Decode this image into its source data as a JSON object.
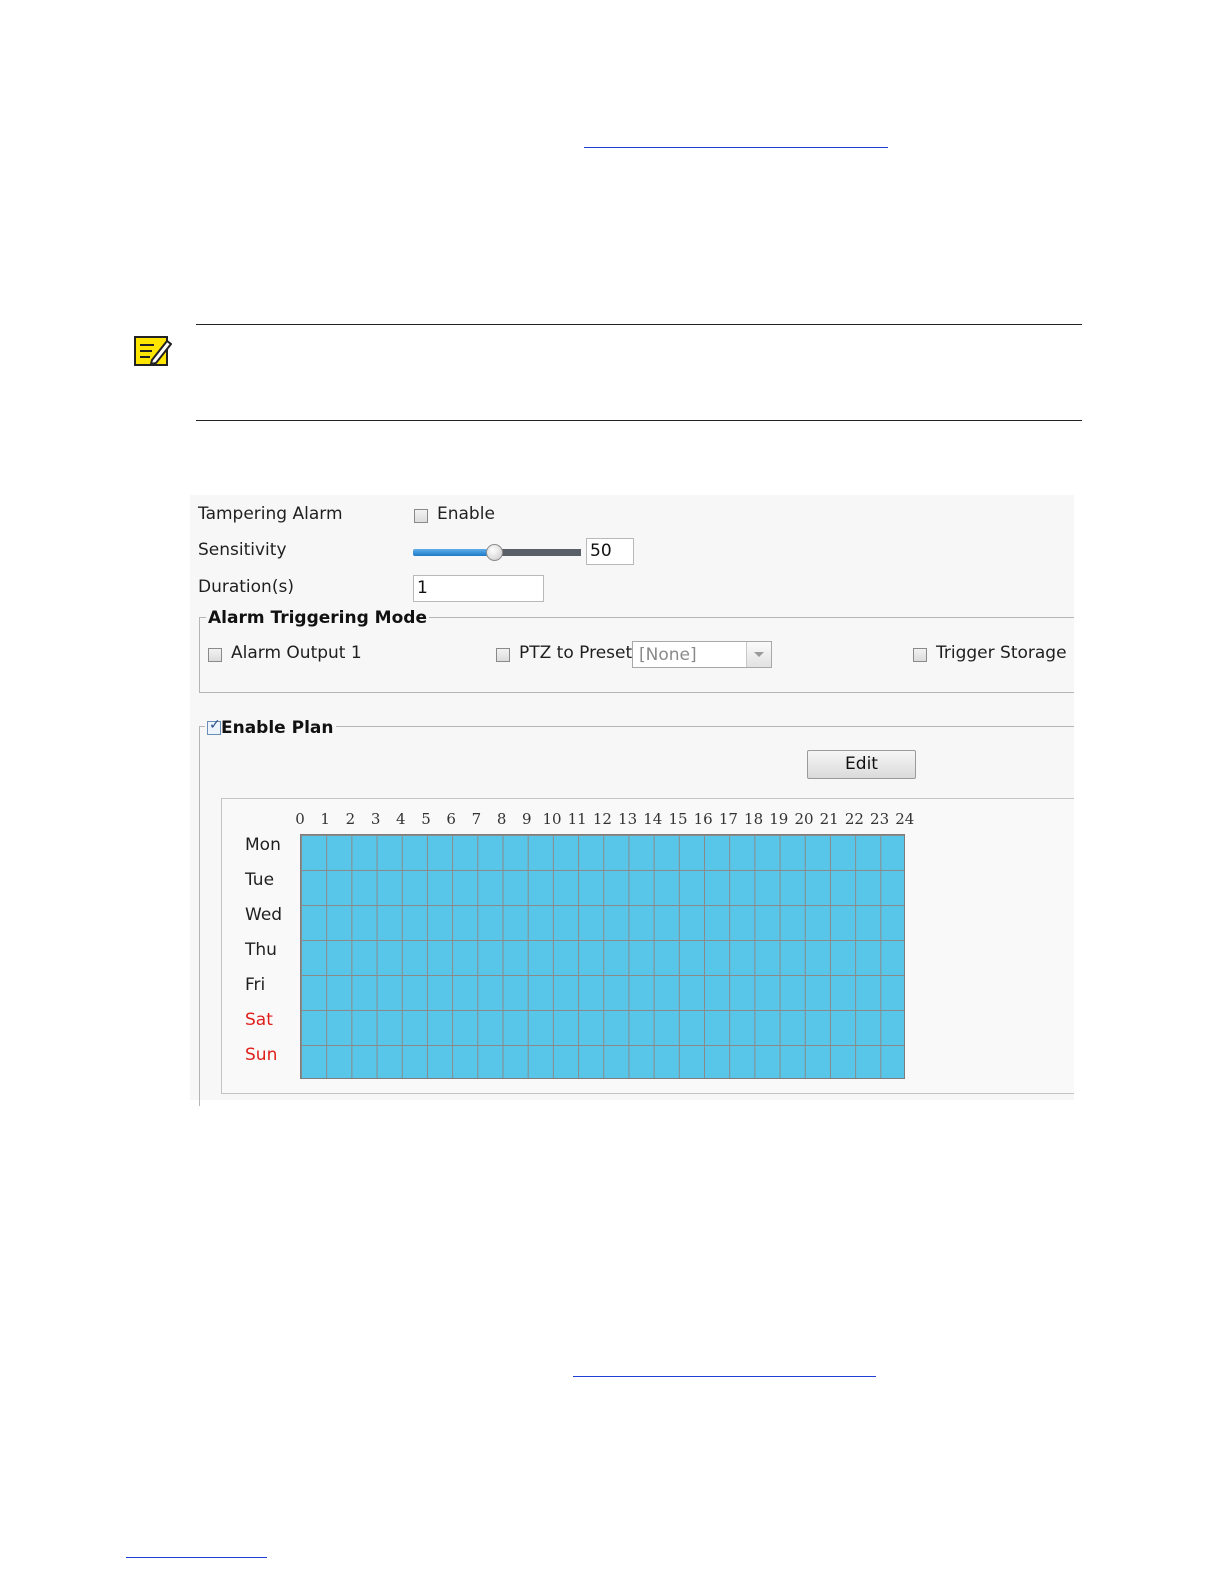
{
  "form": {
    "tampering_alarm_label": "Tampering Alarm",
    "enable_label": "Enable",
    "enable_checked": false,
    "sensitivity_label": "Sensitivity",
    "sensitivity_value": "50",
    "sensitivity_level": 50,
    "duration_label": "Duration(s)",
    "duration_value": "1"
  },
  "alarm_mode": {
    "title": "Alarm Triggering Mode",
    "alarm_output_label": "Alarm Output 1",
    "ptz_label": "PTZ to Preset",
    "ptz_selected": "[None]",
    "trigger_storage_label": "Trigger Storage"
  },
  "plan": {
    "title": "Enable Plan",
    "enabled": true,
    "edit_label": "Edit",
    "hours": [
      "0",
      "1",
      "2",
      "3",
      "4",
      "5",
      "6",
      "7",
      "8",
      "9",
      "10",
      "11",
      "12",
      "13",
      "14",
      "15",
      "16",
      "17",
      "18",
      "19",
      "20",
      "21",
      "22",
      "23",
      "24"
    ],
    "days": [
      {
        "label": "Mon",
        "weekend": false
      },
      {
        "label": "Tue",
        "weekend": false
      },
      {
        "label": "Wed",
        "weekend": false
      },
      {
        "label": "Thu",
        "weekend": false
      },
      {
        "label": "Fri",
        "weekend": false
      },
      {
        "label": "Sat",
        "weekend": true
      },
      {
        "label": "Sun",
        "weekend": true
      }
    ],
    "fill_color": "#58c6e8",
    "weekend_color": "#e0201c"
  }
}
